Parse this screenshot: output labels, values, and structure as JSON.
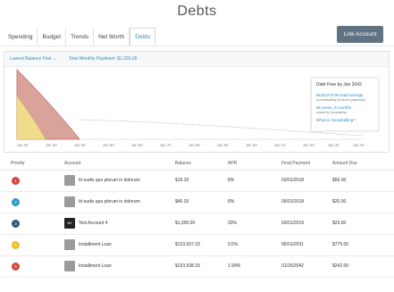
{
  "page": {
    "title": "Debts"
  },
  "tabs": [
    {
      "label": "Spending"
    },
    {
      "label": "Budget"
    },
    {
      "label": "Trends"
    },
    {
      "label": "Net Worth"
    },
    {
      "label": "Debts",
      "active": true
    }
  ],
  "link_account_label": "Link Account",
  "panel": {
    "sort_label": "Lowest Balance First ⌄",
    "paydown_label": "Total Monthly Paydown: $1,326.00"
  },
  "chart": {
    "x_ticks": [
      "Jan 20",
      "Jan 30",
      "Jan 40",
      "Jan 50",
      "Jan 60",
      "Jan 70",
      "Jan 80",
      "Jan 90",
      "Jan 00",
      "Jan 10",
      "Jan 20",
      "Jan 30",
      "Jan 40"
    ],
    "colors": {
      "red_area": "#d9a39b",
      "yellow_area": "#f1dc8e",
      "baseline": "#d0d0d0"
    }
  },
  "info_card": {
    "title": "Debt Free by Jan 2042",
    "savings": "$183,074.95 total savings",
    "savings_sub": "by snowballing (minimum payments)",
    "years": "66 years, 9 months",
    "years_sub": "sooner by snowballing",
    "link": "What is Snowballing?"
  },
  "table": {
    "headers": {
      "priority": "Priority",
      "account": "Account",
      "balance": "Balance",
      "apr": "APR",
      "final_payment": "Final Payment",
      "amount_due": "Amount Due"
    },
    "rows": [
      {
        "priority": "1",
        "badge_color": "#d2493e",
        "icon": "bank-icon",
        "account": "Id eudis quo plorum in dolorum",
        "balance": "$19.33",
        "apr": "8%",
        "final_payment": "03/01/2018",
        "amount_due": "$56.00"
      },
      {
        "priority": "2",
        "badge_color": "#2b9bc0",
        "icon": "bank-icon",
        "account": "Id eudis quo plorum in dolorum",
        "balance": "$46.33",
        "apr": "8%",
        "final_payment": "05/01/2018",
        "amount_due": "$20.00"
      },
      {
        "priority": "3",
        "badge_color": "#3c5468",
        "icon": "mx-logo-icon",
        "icon_text": "MX",
        "account": "Test Account 4",
        "balance": "$1,000.00",
        "apr": "20%",
        "final_payment": "03/01/2019",
        "amount_due": "$23.00"
      },
      {
        "priority": "4",
        "badge_color": "#efbe2a",
        "icon": "bank-icon",
        "account": "Installment Loan",
        "balance": "$133,937.33",
        "apr": "0.5%",
        "final_payment": "05/01/2031",
        "amount_due": "$775.00"
      },
      {
        "priority": "5",
        "badge_color": "#d2493e",
        "icon": "bank-icon",
        "account": "Installment Loan",
        "balance": "$133,938.33",
        "apr": "1.99%",
        "final_payment": "01/25/2042",
        "amount_due": "$242.00"
      }
    ]
  }
}
